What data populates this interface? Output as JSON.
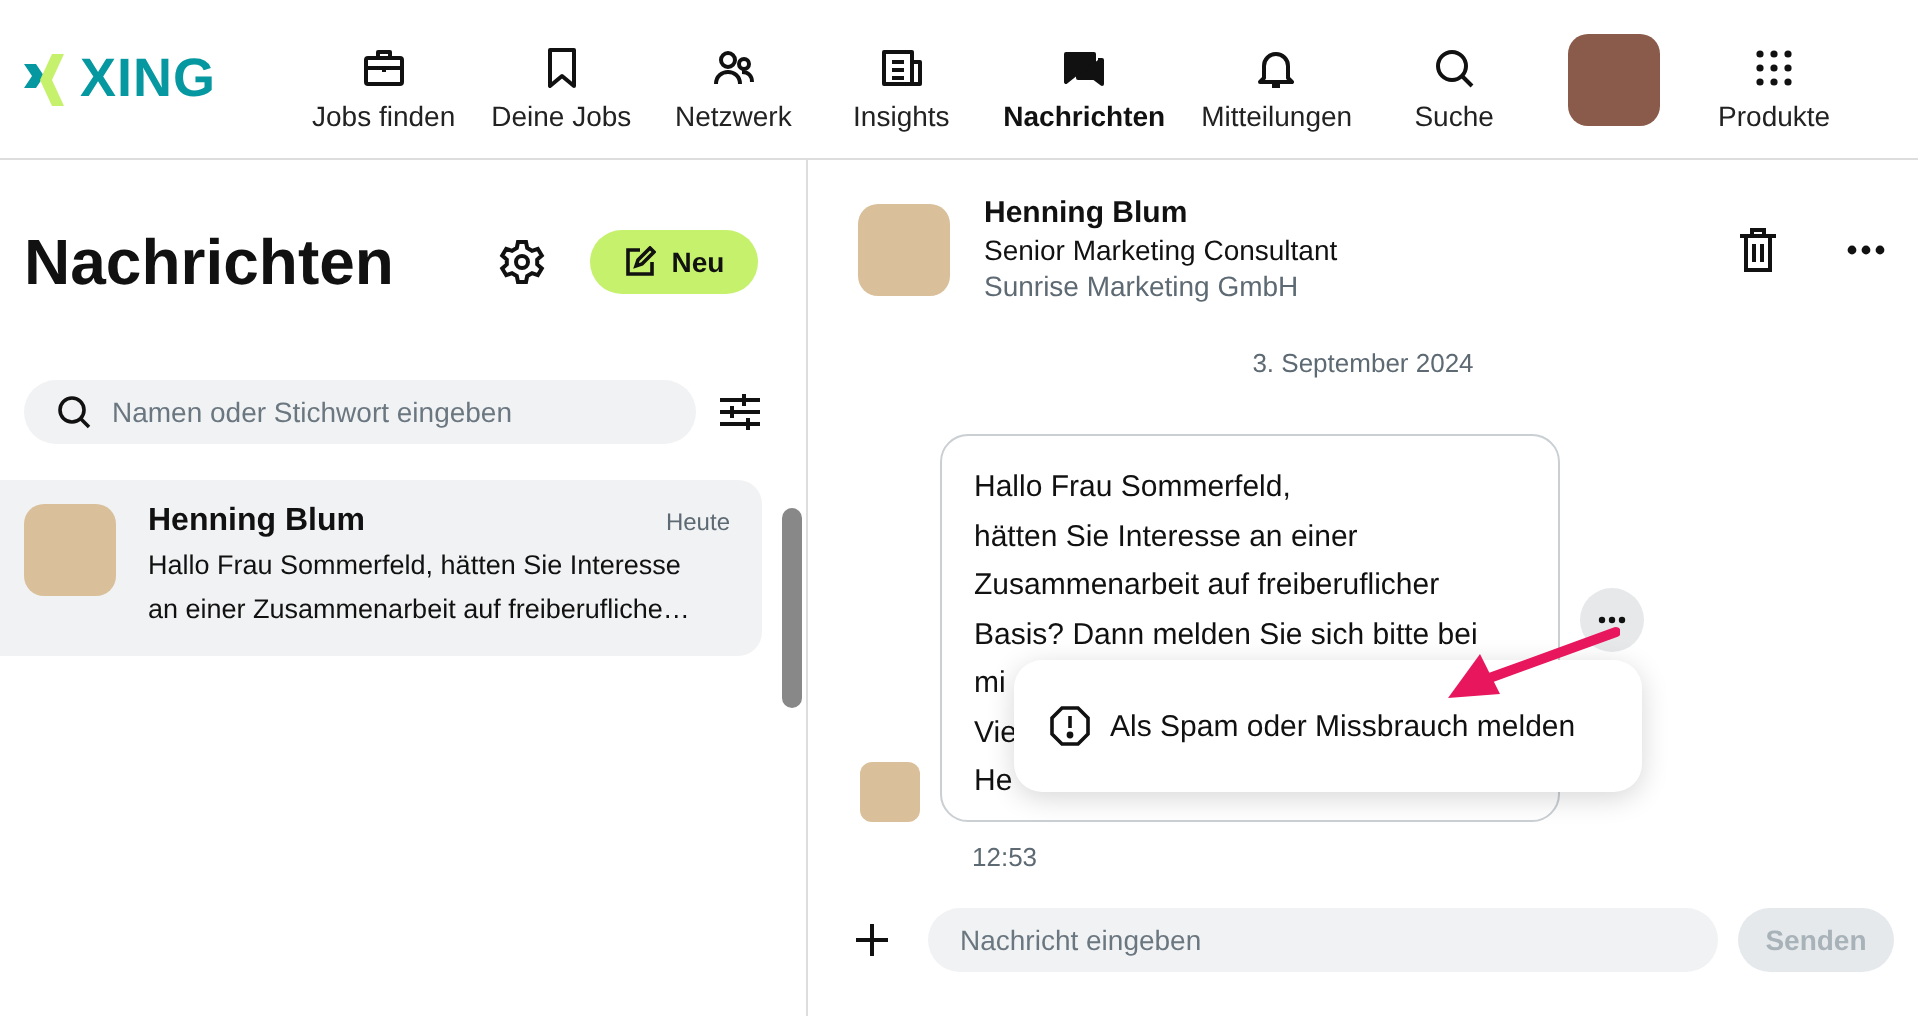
{
  "brand": {
    "logo": "XING"
  },
  "nav": [
    {
      "kind": "briefcase",
      "label": "Jobs finden",
      "selected": false
    },
    {
      "kind": "bookmark",
      "label": "Deine Jobs",
      "selected": false
    },
    {
      "kind": "people",
      "label": "Netzwerk",
      "selected": false
    },
    {
      "kind": "news",
      "label": "Insights",
      "selected": false
    },
    {
      "kind": "chat",
      "label": "Nachrichten",
      "selected": true
    },
    {
      "kind": "bell",
      "label": "Mitteilungen",
      "selected": false
    },
    {
      "kind": "search",
      "label": "Suche",
      "selected": false
    },
    {
      "kind": "avatar",
      "selected": false
    },
    {
      "kind": "grid",
      "label": "Produkte",
      "selected": false
    }
  ],
  "sidebar": {
    "title": "Nachrichten",
    "new_button": "Neu",
    "search": {
      "placeholder": "Namen oder Stichwort eingeben"
    },
    "conversations": [
      {
        "name": "Henning Blum",
        "time": "Heute",
        "preview_lines": [
          "Hallo Frau Sommerfeld, hätten Sie Interesse",
          "an einer Zusammenarbeit auf freiberufliche…"
        ],
        "selected": true
      }
    ]
  },
  "conversation": {
    "contact": {
      "name": "Henning Blum",
      "title": "Senior Marketing Consultant",
      "company": "Sunrise Marketing GmbH"
    },
    "date": "3. September 2024",
    "message": {
      "lines": [
        "Hallo Frau Sommerfeld,",
        "hätten Sie Interesse an einer",
        "Zusammenarbeit auf freiberuflicher",
        "Basis? Dann melden Sie sich bitte bei",
        "mi",
        "Vie",
        "He"
      ],
      "time": "12:53"
    },
    "context_menu": {
      "item": "Als Spam oder Missbrauch melden"
    },
    "composer": {
      "placeholder": "Nachricht eingeben",
      "send_button": "Senden",
      "send_disabled": true
    }
  }
}
